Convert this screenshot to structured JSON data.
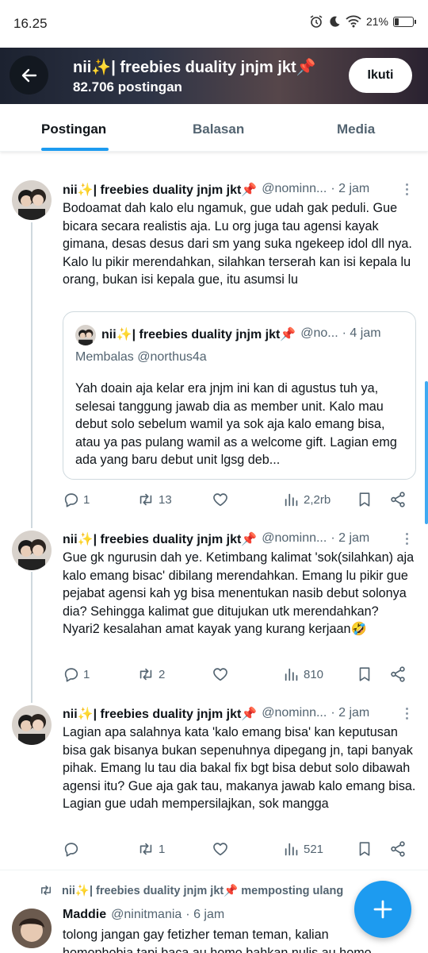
{
  "status_bar": {
    "time": "16.25",
    "battery": "21%",
    "battery_level": 0.21
  },
  "header": {
    "title": "nii✨| freebies duality jnjm jkt📌",
    "post_count": "82.706 postingan",
    "follow_label": "Ikuti"
  },
  "tabs": [
    {
      "label": "Postingan",
      "active": true
    },
    {
      "label": "Balasan",
      "active": false
    },
    {
      "label": "Media",
      "active": false
    }
  ],
  "tweets": [
    {
      "name": "nii✨| freebies duality jnjm jkt📌",
      "handle": "@nominn...",
      "time": "· 2 jam",
      "text": "Bodoamat dah kalo elu ngamuk, gue udah gak peduli. Gue bicara secara realistis aja. Lu org juga tau agensi kayak gimana, desas desus dari sm yang suka ngekeep idol dll nya. Kalo lu pikir merendahkan, silahkan terserah kan isi kepala lu orang, bukan isi kepala gue, itu asumsi lu",
      "quote": {
        "name": "nii✨| freebies duality jnjm jkt📌",
        "handle": "@no...",
        "time": "· 4 jam",
        "reply_to": "Membalas @northus4a",
        "text": "Yah doain aja kelar era jnjm ini kan di agustus tuh ya, selesai tanggung jawab dia as member unit. Kalo mau debut solo sebelum wamil ya sok aja kalo emang bisa, atau ya pas pulang wamil as a welcome gift. Lagian emg ada yang baru debut unit lgsg deb..."
      },
      "replies": "1",
      "reposts": "13",
      "likes": "",
      "views": "2,2rb"
    },
    {
      "name": "nii✨| freebies duality jnjm jkt📌",
      "handle": "@nominn...",
      "time": "· 2 jam",
      "text": "Gue gk ngurusin dah ye. Ketimbang kalimat 'sok(silahkan) aja kalo emang bisac' dibilang merendahkan. Emang lu pikir gue pejabat agensi kah yg bisa menentukan nasib debut solonya dia? Sehingga kalimat gue ditujukan utk merendahkan? Nyari2 kesalahan amat kayak yang kurang kerjaan🤣",
      "replies": "1",
      "reposts": "2",
      "likes": "",
      "views": "810"
    },
    {
      "name": "nii✨| freebies duality jnjm jkt📌",
      "handle": "@nominn...",
      "time": "· 2 jam",
      "text": "Lagian apa salahnya kata 'kalo emang bisa' kan keputusan bisa gak bisanya bukan sepenuhnya dipegang jn, tapi banyak pihak. Emang lu tau dia bakal fix bgt bisa debut solo dibawah agensi itu? Gue aja gak tau, makanya jawab kalo emang bisa. Lagian gue udah mempersilajkan, sok mangga",
      "replies": "",
      "reposts": "1",
      "likes": "",
      "views": "521"
    }
  ],
  "repost_notice": "nii✨| freebies duality jnjm jkt📌 memposting ulang",
  "last_tweet": {
    "name": "Maddie",
    "handle": "@ninitmania",
    "time": "· 6 jam",
    "text": "tolong jangan gay fetizher teman teman, kalian homophobia tapi baca au homo bahkan nulis au homo"
  },
  "colors": {
    "accent": "#1d9bf0",
    "text": "#0f1419",
    "muted": "#536471",
    "border": "#cfd9de"
  },
  "icons": [
    "back-arrow-icon",
    "alarm-icon",
    "moon-icon",
    "wifi-icon",
    "battery-icon",
    "reply-icon",
    "repost-icon",
    "like-icon",
    "views-icon",
    "bookmark-icon",
    "share-icon",
    "more-icon",
    "plus-icon"
  ]
}
